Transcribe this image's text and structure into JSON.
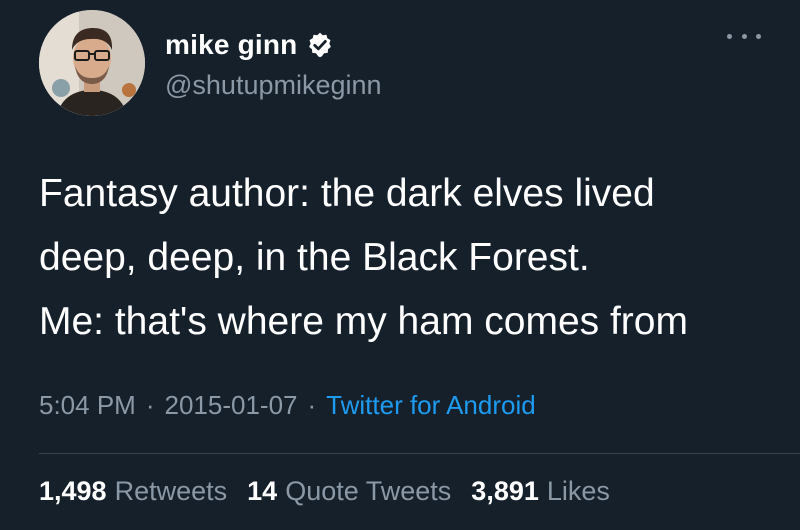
{
  "tweet": {
    "display_name": "mike ginn",
    "handle": "@shutupmikeginn",
    "verified": true,
    "text_lines": [
      "Fantasy author: the dark elves lived",
      "deep, deep, in the Black Forest.",
      "Me: that's where my ham comes from"
    ],
    "time": "5:04 PM",
    "separator": "·",
    "date": "2015-01-07",
    "source": "Twitter for Android",
    "stats": {
      "retweets_count": "1,498",
      "retweets_label": "Retweets",
      "quotes_count": "14",
      "quotes_label": "Quote Tweets",
      "likes_count": "3,891",
      "likes_label": "Likes"
    }
  },
  "icons": {
    "verified": "verified-badge-icon",
    "more": "more-horizontal-icon"
  },
  "colors": {
    "background": "#15202b",
    "primary_text": "#ffffff",
    "secondary_text": "#8b98a5",
    "link": "#1d9bf0",
    "divider": "#38444d"
  }
}
